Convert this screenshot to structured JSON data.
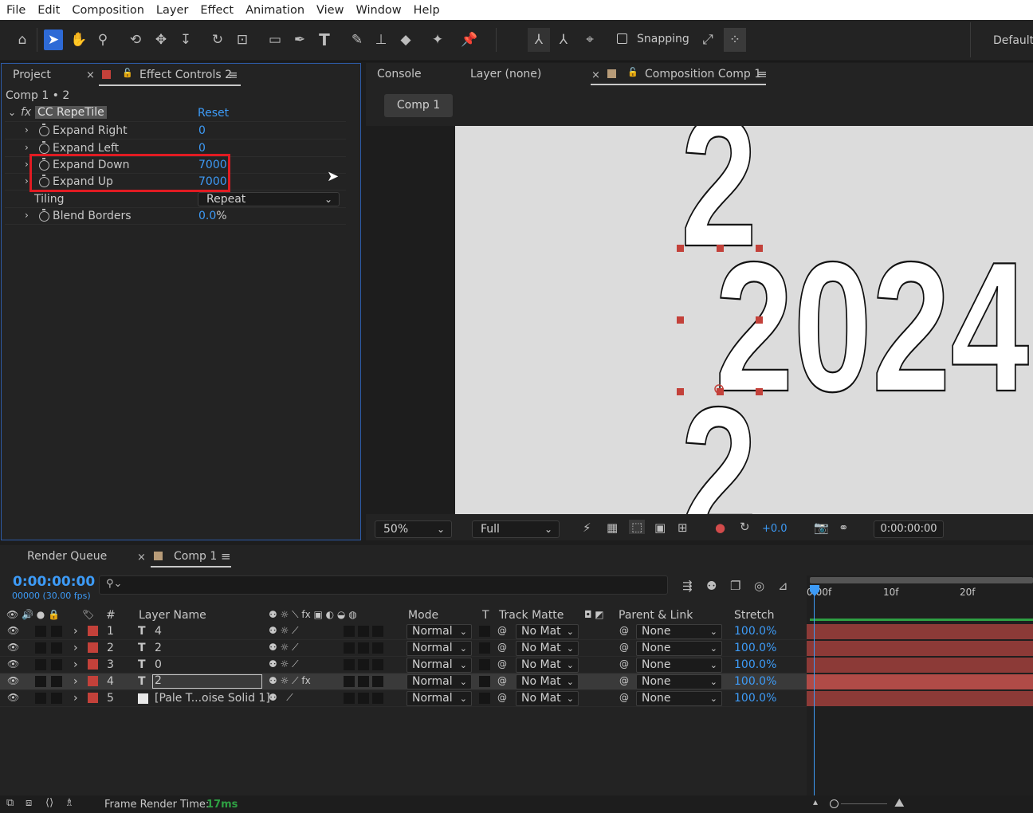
{
  "menu": [
    "File",
    "Edit",
    "Composition",
    "Layer",
    "Effect",
    "Animation",
    "View",
    "Window",
    "Help"
  ],
  "toolbar": {
    "snapping_label": "Snapping",
    "workspace_label": "Default"
  },
  "left_panel": {
    "tabs": {
      "project": "Project",
      "effect_controls": "Effect Controls 2"
    },
    "breadcrumb": "Comp 1 • 2",
    "effect": {
      "name": "CC RepeTile",
      "reset": "Reset"
    },
    "properties": [
      {
        "name": "Expand Right",
        "value": "0"
      },
      {
        "name": "Expand Left",
        "value": "0"
      },
      {
        "name": "Expand Down",
        "value": "7000"
      },
      {
        "name": "Expand Up",
        "value": "7000"
      }
    ],
    "tiling": {
      "label": "Tiling",
      "value": "Repeat"
    },
    "blend": {
      "label": "Blend Borders",
      "value": "0.0",
      "unit": "%"
    }
  },
  "viewer": {
    "tabs": {
      "console": "Console",
      "layer": "Layer (none)",
      "composition": "Composition Comp 1"
    },
    "comp_button": "Comp 1",
    "canvas_text": {
      "main": "2024",
      "top": "2",
      "bottom": "2"
    },
    "zoom": "50%",
    "resolution": "Full",
    "exposure": "+0.0",
    "timecode": "0:00:00:00"
  },
  "timeline": {
    "tabs": {
      "render_queue": "Render Queue",
      "comp": "Comp 1"
    },
    "timecode": "0:00:00:00",
    "fps": "00000 (30.00 fps)",
    "columns": {
      "num": "#",
      "layer_name": "Layer Name",
      "mode": "Mode",
      "t": "T",
      "track_matte": "Track Matte",
      "parent": "Parent & Link",
      "stretch": "Stretch"
    },
    "ruler": [
      "0:00f",
      "10f",
      "20f"
    ],
    "layers": [
      {
        "num": "1",
        "type": "T",
        "name": "4",
        "mode": "Normal",
        "matte": "No Mat",
        "parent": "None",
        "stretch": "100.0%"
      },
      {
        "num": "2",
        "type": "T",
        "name": "2",
        "mode": "Normal",
        "matte": "No Mat",
        "parent": "None",
        "stretch": "100.0%"
      },
      {
        "num": "3",
        "type": "T",
        "name": "0",
        "mode": "Normal",
        "matte": "No Mat",
        "parent": "None",
        "stretch": "100.0%"
      },
      {
        "num": "4",
        "type": "T",
        "name": "2",
        "mode": "Normal",
        "matte": "No Mat",
        "parent": "None",
        "stretch": "100.0%"
      },
      {
        "num": "5",
        "type": "",
        "name": "[Pale T...oise Solid 1]",
        "mode": "Normal",
        "matte": "No Mat",
        "parent": "None",
        "stretch": "100.0%"
      }
    ]
  },
  "status": {
    "label": "Frame Render Time:",
    "value": "17ms"
  },
  "colors": {
    "accent": "#3d9bf7",
    "label_red": "#c3413a",
    "highlight": "#e11b22"
  }
}
